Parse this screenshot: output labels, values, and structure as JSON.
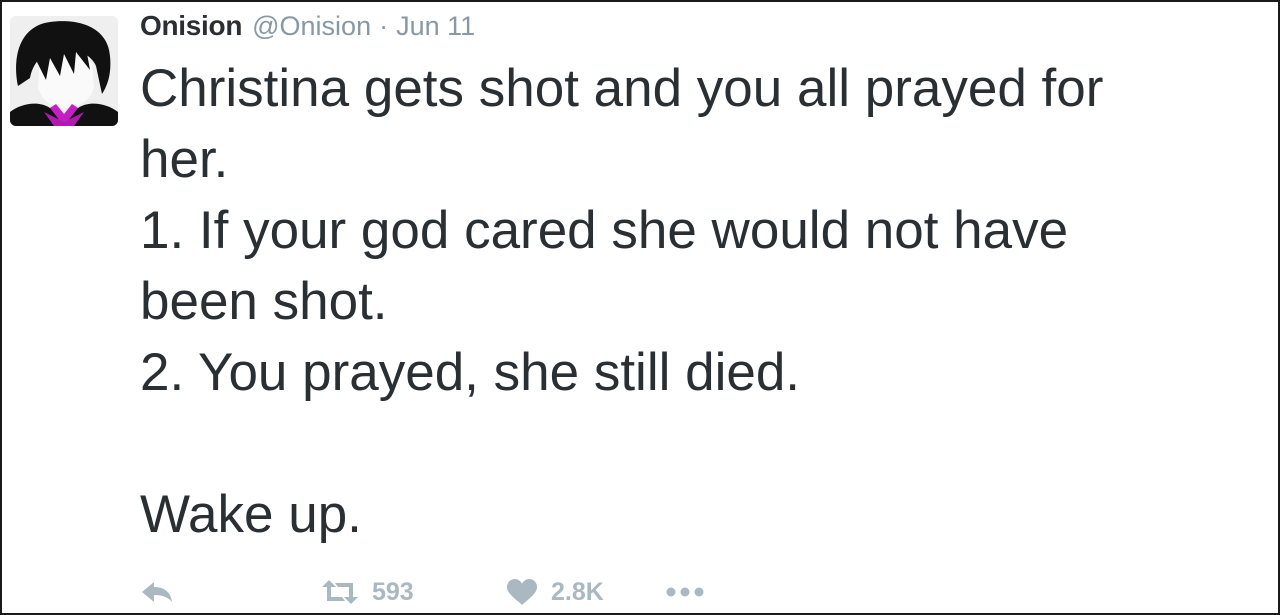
{
  "tweet": {
    "display_name": "Onision",
    "handle": "@Onision",
    "separator": "·",
    "date": "Jun 11",
    "lines": [
      "Christina gets shot and you all prayed for",
      "her.",
      "1. If your god cared she would not have",
      "been shot.",
      "2. You prayed, she still died.",
      "",
      "Wake up."
    ]
  },
  "actions": {
    "retweet_count": "593",
    "like_count": "2.8K"
  },
  "icons": {
    "reply": "reply-icon",
    "retweet": "retweet-icon",
    "like": "heart-icon",
    "more": "more-dots-icon"
  },
  "colors": {
    "text": "#292f33",
    "muted": "#8899a6",
    "action": "#aab8c2",
    "avatar_accent": "#c41fc4"
  }
}
